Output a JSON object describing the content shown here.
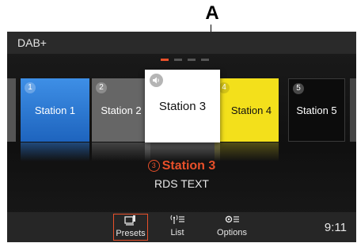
{
  "callout": "A",
  "header": {
    "title": "DAB+"
  },
  "colors": {
    "accent": "#e8502a",
    "station1": "#2f7ad6",
    "station2": "#666666",
    "station3": "#ffffff",
    "station4": "#f3e01b",
    "station5": "#0c0c0c"
  },
  "pager": {
    "pages": 4,
    "active_index": 0
  },
  "presets": [
    {
      "number": "1",
      "name": "Station 1"
    },
    {
      "number": "2",
      "name": "Station 2"
    },
    {
      "number": "",
      "name": "Station 3",
      "icon": "speaker-icon"
    },
    {
      "number": "4",
      "name": "Station 4"
    },
    {
      "number": "5",
      "name": "Station 5"
    }
  ],
  "now_playing": {
    "number": "3",
    "station": "Station 3",
    "rds_text": "RDS TEXT"
  },
  "bottom_bar": {
    "presets_label": "Presets",
    "list_label": "List",
    "options_label": "Options",
    "presets_icon": "presets-icon",
    "list_icon": "antenna-list-icon",
    "options_icon": "gear-list-icon",
    "time": "9:11"
  }
}
